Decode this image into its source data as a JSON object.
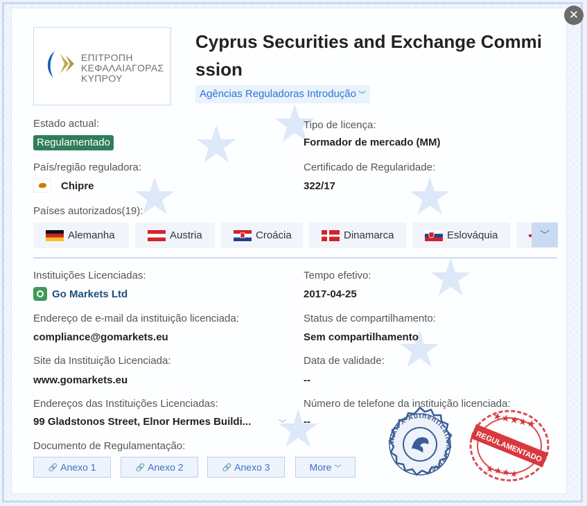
{
  "header": {
    "title": "Cyprus Securities and Exchange Commission",
    "logo_lines": [
      "ΕΠΙΤΡΟΠΗ",
      "ΚΕΦΑΛΑΙΑΓΟΡΑΣ",
      "ΚΥΠΡΟΥ"
    ],
    "intro_link": "Agências Reguladoras Introdução"
  },
  "fields": {
    "status_label": "Estado actual:",
    "status_value": "Regulamentado",
    "license_type_label": "Tipo de licença:",
    "license_type_value": "Formador de mercado (MM)",
    "country_label": "País/região reguladora:",
    "country_value": "Chipre",
    "certificate_label": "Certificado de Regularidade:",
    "certificate_value": "322/17",
    "authorized_label": "Países autorizados(19):",
    "institution_label": "Instituições Licenciadas:",
    "institution_value": "Go Markets Ltd",
    "effective_label": "Tempo efetivo:",
    "effective_value": "2017-04-25",
    "email_label": "Endereço de e-mail da instituição licenciada:",
    "email_value": "compliance@gomarkets.eu",
    "sharing_label": "Status de compartilhamento:",
    "sharing_value": "Sem compartilhamento",
    "site_label": "Site da Instituição Licenciada:",
    "site_value": "www.gomarkets.eu",
    "validity_label": "Data de validade:",
    "validity_value": "--",
    "address_label": "Endereços das Instituições Licenciadas:",
    "address_value": "99 Gladstonos Street, Elnor Hermes Buildi...",
    "phone_label": "Número de telefone da instituição licenciada:",
    "phone_value": "--",
    "documents_label": "Documento de Regulamentação:"
  },
  "countries": [
    {
      "name": "Alemanha"
    },
    {
      "name": "Austria"
    },
    {
      "name": "Croácia"
    },
    {
      "name": "Dinamarca"
    },
    {
      "name": "Eslováquia"
    }
  ],
  "documents": [
    "Anexo 1",
    "Anexo 2",
    "Anexo 3"
  ],
  "more_label": "More",
  "seals": {
    "auth_text": "WikiFX Authentication Center",
    "stamp_text": "REGULAMENTADO"
  },
  "colors": {
    "accent": "#2f73d4",
    "status_badge": "#2f7d5a",
    "stamp_red": "#d8383e",
    "seal_blue": "#3a5d96"
  }
}
